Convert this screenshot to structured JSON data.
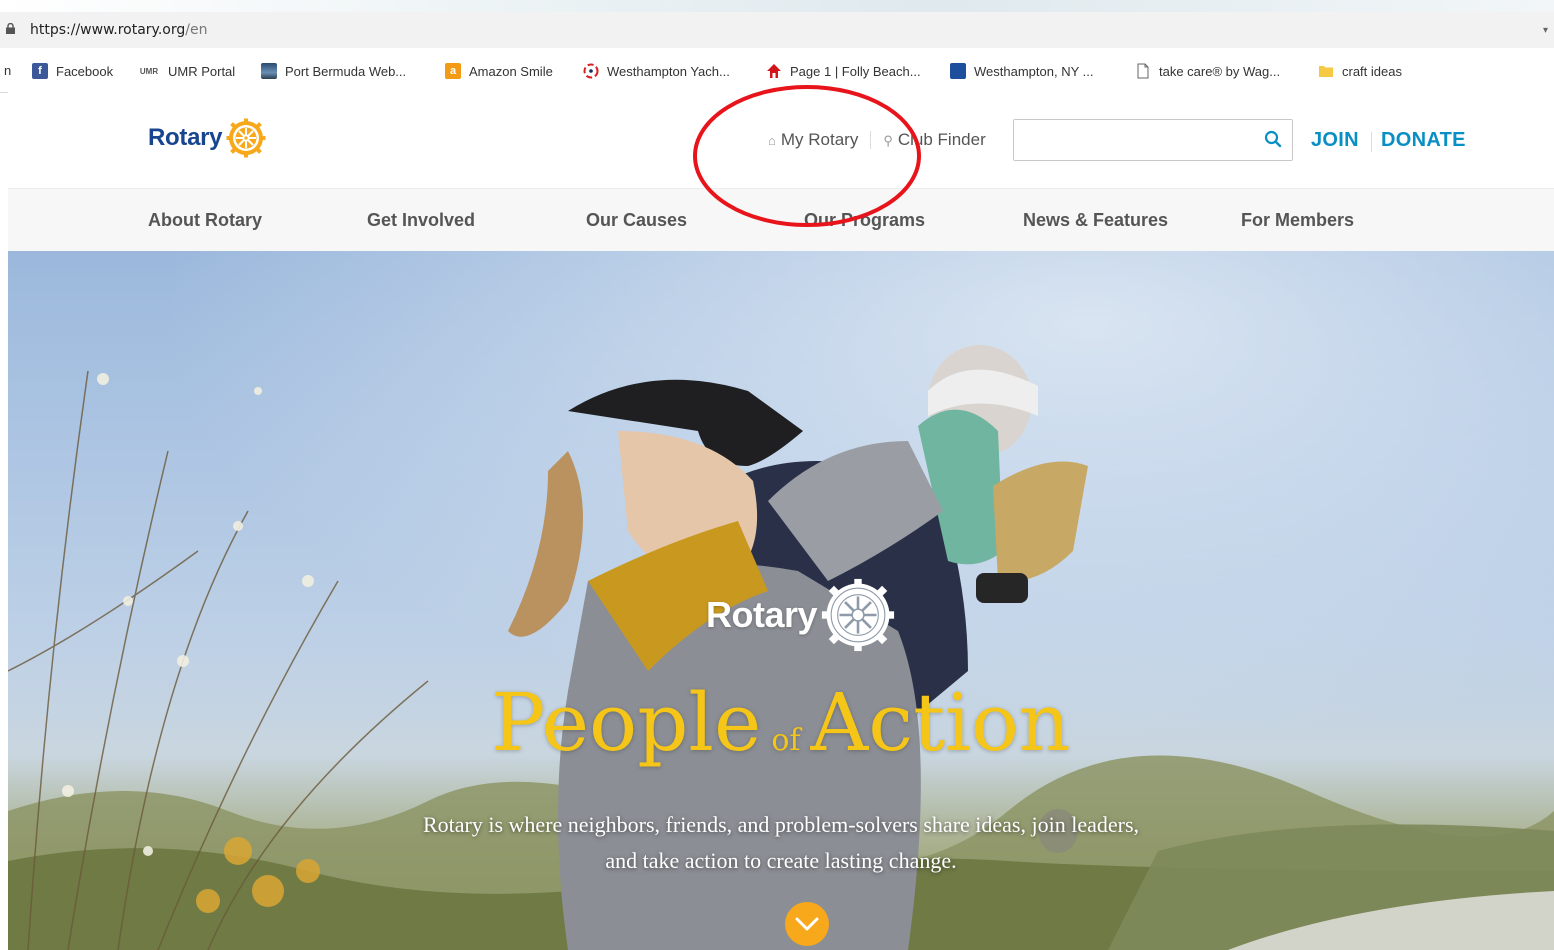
{
  "browser": {
    "url_host": "https://www.rotary.org",
    "url_path": "/en",
    "edge_char": "n",
    "bookmarks": [
      {
        "label": "Facebook",
        "icon": "facebook-icon"
      },
      {
        "label": "UMR Portal",
        "icon": "umr-icon"
      },
      {
        "label": "Port Bermuda Web...",
        "icon": "site-thumbnail-icon"
      },
      {
        "label": "Amazon Smile",
        "icon": "amazon-icon"
      },
      {
        "label": "Westhampton Yach...",
        "icon": "yacht-club-icon"
      },
      {
        "label": "Page 1 | Folly Beach...",
        "icon": "house-icon"
      },
      {
        "label": "Westhampton, NY ...",
        "icon": "weather-channel-icon"
      },
      {
        "label": "take care® by Wag...",
        "icon": "page-icon"
      },
      {
        "label": "craft ideas",
        "icon": "folder-icon"
      }
    ]
  },
  "header": {
    "logo_text": "Rotary",
    "my_rotary": "My Rotary",
    "club_finder": "Club Finder",
    "search_placeholder": "",
    "join": "JOIN",
    "donate": "DONATE"
  },
  "nav": {
    "items": [
      "About Rotary",
      "Get Involved",
      "Our Causes",
      "Our Programs",
      "News & Features",
      "For Members"
    ]
  },
  "hero": {
    "logo_text": "Rotary",
    "headline_part1": "People",
    "headline_of": "of",
    "headline_part2": "Action",
    "tagline_line1": "Rotary is where neighbors, friends, and problem-solvers share ideas, join leaders,",
    "tagline_line2": "and take action to create lasting change."
  },
  "colors": {
    "rotary_blue": "#17458f",
    "link_blue": "#0a8fc5",
    "gold": "#f7a81b",
    "headline_gold": "#f5c518",
    "annotation_red": "#e8141b"
  }
}
